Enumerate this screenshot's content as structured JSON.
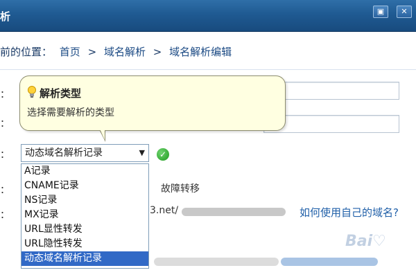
{
  "window": {
    "title": "析",
    "minmax_icon": "▣",
    "close_icon": "✕"
  },
  "breadcrumb": {
    "prefix": "前的位置：",
    "items": [
      "首页",
      "域名解析",
      "域名解析编辑"
    ],
    "separator": ">"
  },
  "form": {
    "row1_label": "：",
    "row2_label": "：",
    "row3_label": "：",
    "row4_label": "：",
    "row5_label": "：",
    "select_value": "动态域名解析记录",
    "options": [
      "A记录",
      "CNAME记录",
      "NS记录",
      "MX记录",
      "URL显性转发",
      "URL隐性转发",
      "动态域名解析记录"
    ],
    "selected_index": 6
  },
  "tooltip": {
    "title": "解析类型",
    "body": "选择需要解析的类型"
  },
  "side": {
    "failover_text": "故障转移",
    "domain_partial": "3.net/",
    "help_link": "如何使用自己的域名?"
  },
  "watermark": "Bai♡",
  "colors": {
    "titlebar": "#1f5a92",
    "tooltip_bg": "#ffffe1",
    "selection": "#3169c6",
    "link": "#1f5fa8",
    "check": "#1f9a1f"
  }
}
